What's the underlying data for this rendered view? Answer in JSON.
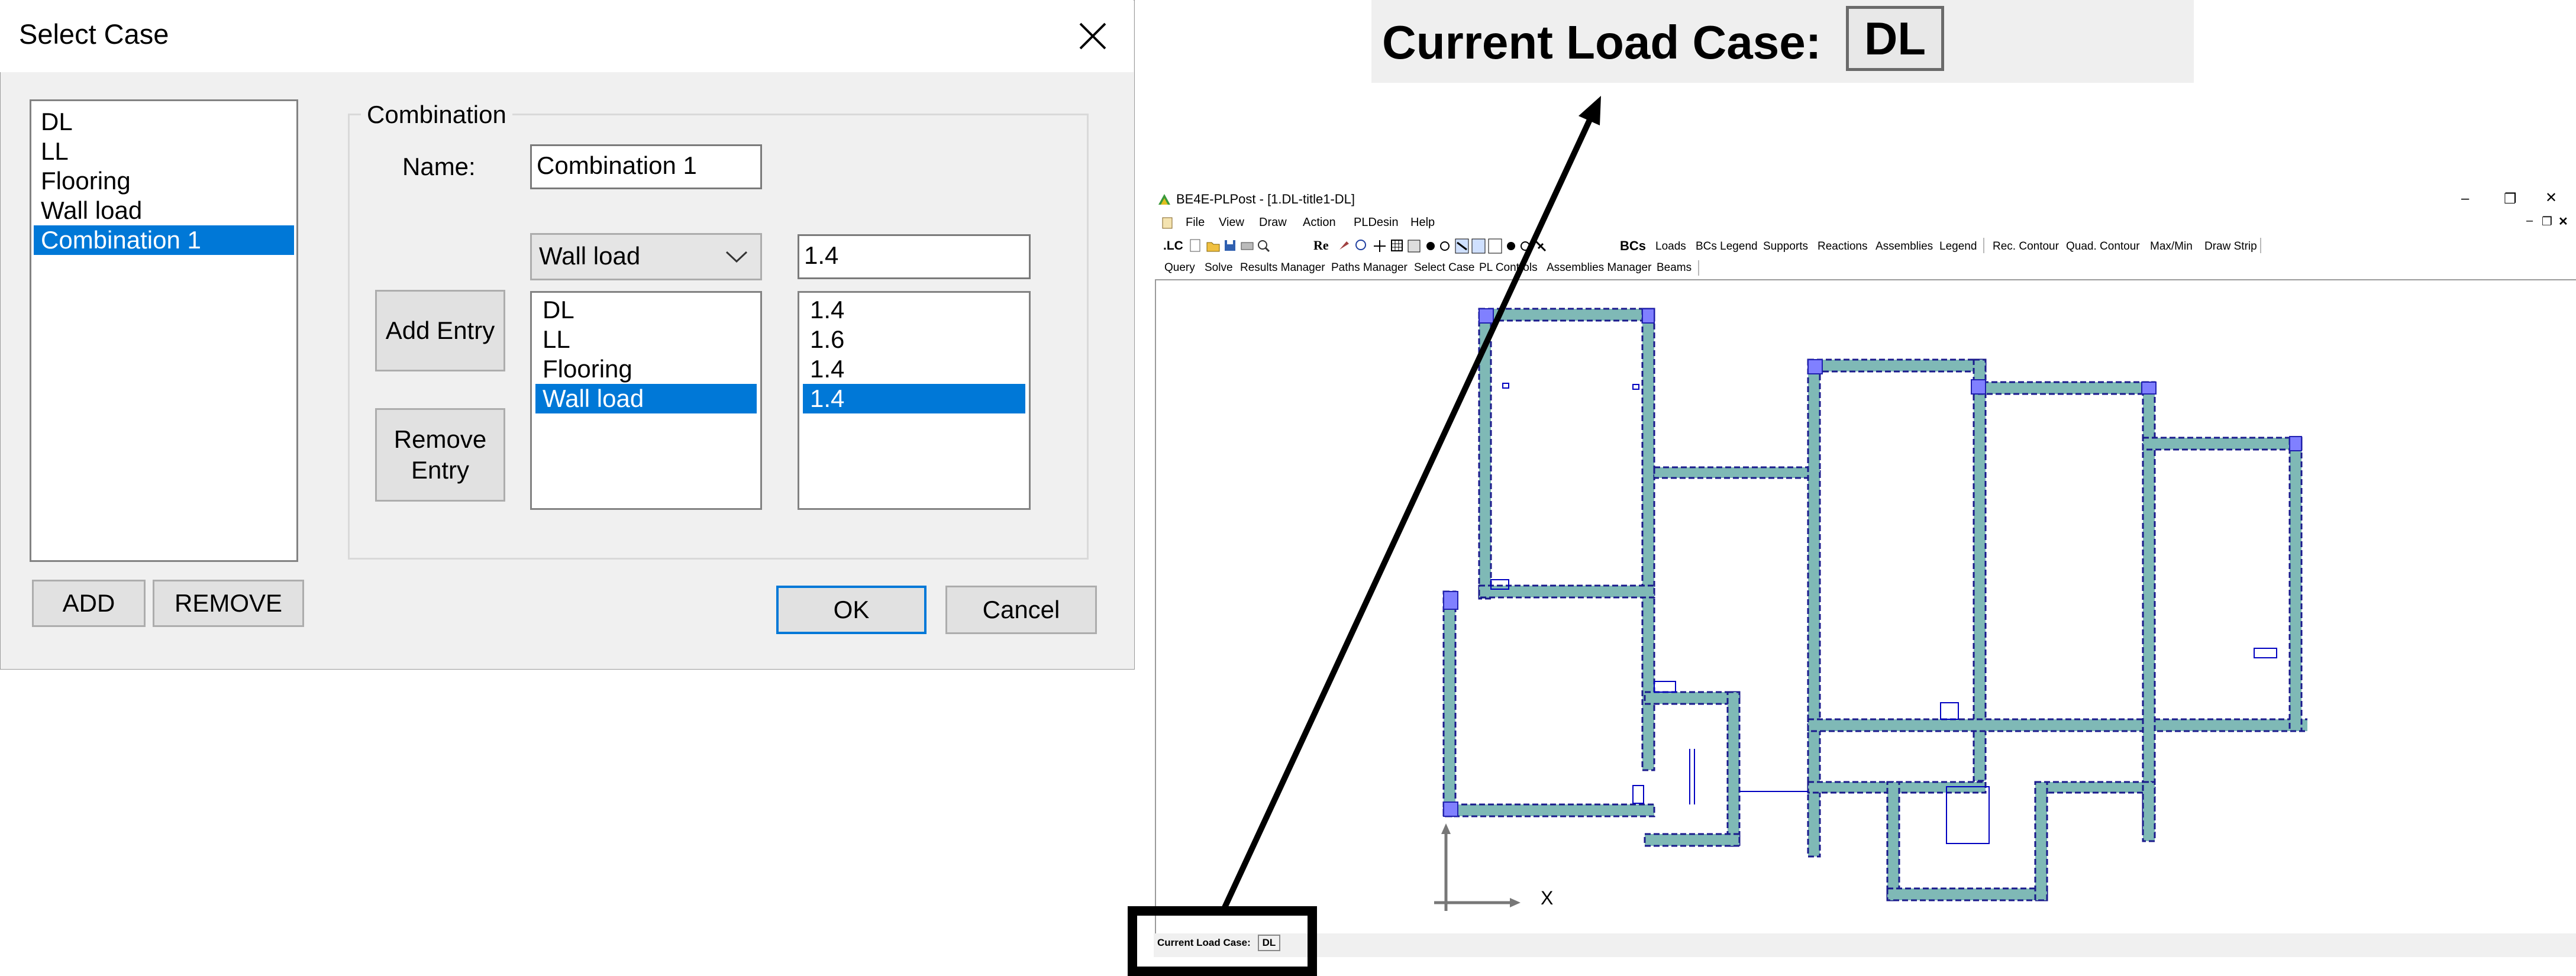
{
  "dialog": {
    "title": "Select Case",
    "cases": [
      "DL",
      "LL",
      "Flooring",
      "Wall load",
      "Combination 1"
    ],
    "selected_case_index": 4,
    "add_label": "ADD",
    "remove_label": "REMOVE",
    "combination_group_label": "Combination",
    "name_label": "Name:",
    "name_value": "Combination 1",
    "case_select_value": "Wall load",
    "factor_value": "1.4",
    "add_entry_label": "Add Entry",
    "remove_entry_label": "Remove Entry",
    "entry_cases": [
      "DL",
      "LL",
      "Flooring",
      "Wall load"
    ],
    "entry_factors": [
      "1.4",
      "1.6",
      "1.4",
      "1.4"
    ],
    "selected_entry_index": 3,
    "ok_label": "OK",
    "cancel_label": "Cancel"
  },
  "zoom": {
    "label": "Current Load Case:",
    "value": "DL"
  },
  "app": {
    "title": "BE4E-PLPost - [1.DL-title1-DL]",
    "menu": [
      "File",
      "View",
      "Draw",
      "Action",
      "PLDesin",
      "Help"
    ],
    "toolbar1_text": ".LC",
    "toolbar1_re": "Re",
    "toolbar1_bcs": "BCs",
    "toolbar1_items": [
      "Loads",
      "BCs Legend",
      "Supports",
      "Reactions",
      "Assemblies",
      "Legend"
    ],
    "toolbar1_items2": [
      "Rec. Contour",
      "Quad. Contour",
      "Max/Min",
      "Draw Strip"
    ],
    "toolbar2_items": [
      "Query",
      "Solve",
      "Results Manager",
      "Paths Manager",
      "Select Case",
      "PL Controls",
      "Assemblies Manager",
      "Beams"
    ],
    "status_label": "Current Load Case:",
    "status_value": "DL",
    "axis_label": "X"
  },
  "colors": {
    "selection": "#0078d7",
    "wall_fill": "#7fb9b6",
    "wall_edge": "#1a1a8c",
    "support": "#8080ff"
  }
}
